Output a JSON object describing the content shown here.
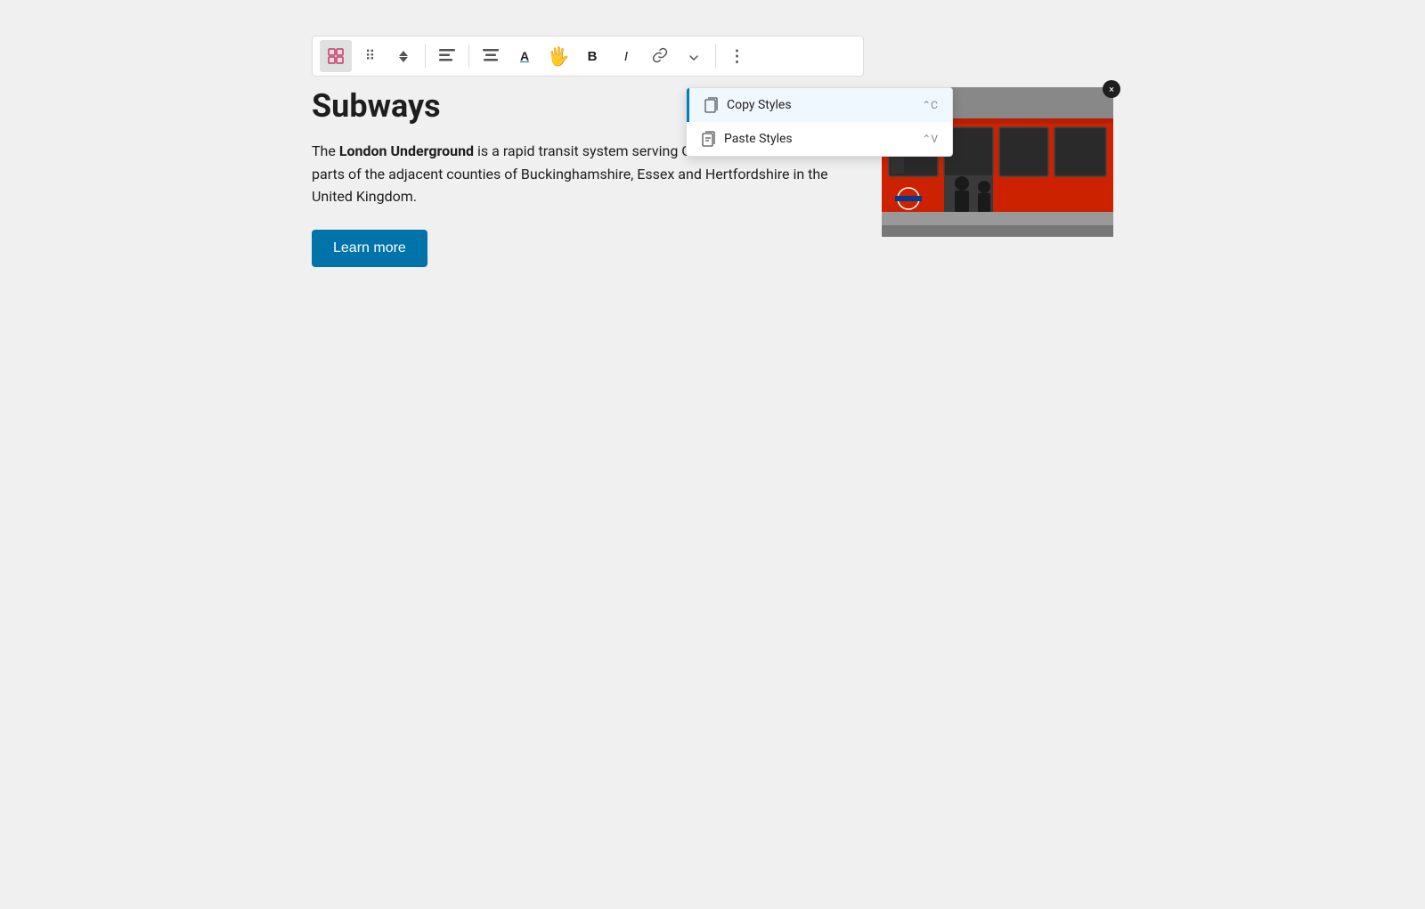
{
  "toolbar": {
    "buttons": [
      {
        "id": "block-switcher",
        "label": "⊞",
        "icon": "block-switcher-icon",
        "active": true
      },
      {
        "id": "drag",
        "label": "⠿",
        "icon": "drag-icon",
        "active": false
      },
      {
        "id": "move-up-down",
        "label": "⬍",
        "icon": "move-updown-icon",
        "active": false
      },
      {
        "id": "align",
        "label": "☰",
        "icon": "align-icon",
        "active": false
      },
      {
        "id": "text-align",
        "label": "≡",
        "icon": "text-align-icon",
        "active": false
      },
      {
        "id": "font-color",
        "label": "A",
        "icon": "font-color-icon",
        "active": false
      },
      {
        "id": "more-styles",
        "label": "✋",
        "icon": "more-styles-icon",
        "active": false
      },
      {
        "id": "bold",
        "label": "B",
        "icon": "bold-icon",
        "active": false
      },
      {
        "id": "italic",
        "label": "I",
        "icon": "italic-icon",
        "active": false
      },
      {
        "id": "link",
        "label": "🔗",
        "icon": "link-icon",
        "active": false
      },
      {
        "id": "dropdown",
        "label": "∨",
        "icon": "dropdown-icon",
        "active": false
      },
      {
        "id": "more-options",
        "label": "⋮",
        "icon": "more-options-icon",
        "active": false
      }
    ]
  },
  "dropdown": {
    "items": [
      {
        "id": "copy-styles",
        "label": "Copy Styles",
        "shortcut": "⌃C",
        "icon": "copy-styles-icon"
      },
      {
        "id": "paste-styles",
        "label": "Paste Styles",
        "shortcut": "⌃V",
        "icon": "paste-styles-icon"
      }
    ]
  },
  "content": {
    "title": "Subways",
    "body_start": "The ",
    "body_bold": "London Underground",
    "body_end": " is a rapid transit system serving Greater London and some parts of the adjacent counties of Buckinghamshire, Essex and Hertfordshire in the United Kingdom.",
    "learn_more_label": "Learn more",
    "image_close_label": "×"
  }
}
